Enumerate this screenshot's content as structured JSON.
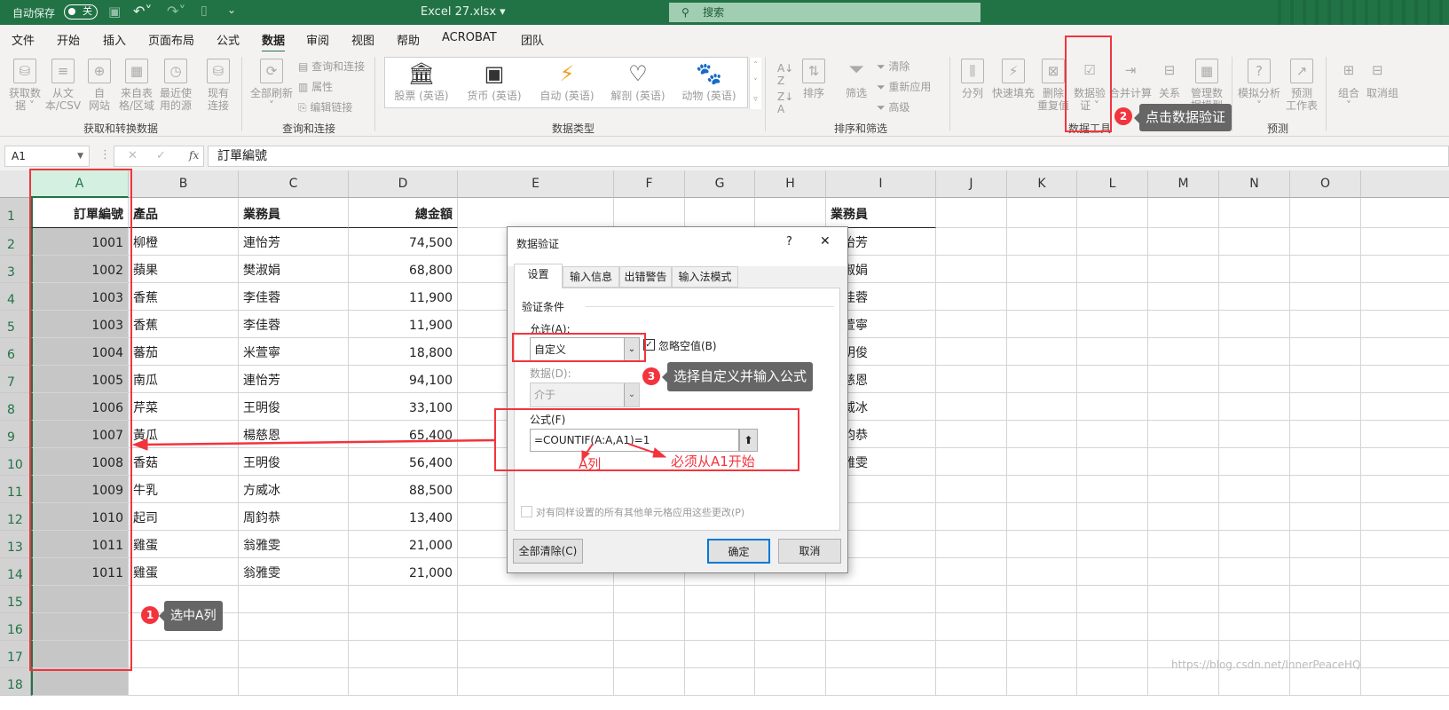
{
  "titlebar": {
    "autosave_label": "自动保存",
    "autosave_state": "关",
    "filename": "Excel 27.xlsx",
    "search_placeholder": "搜索"
  },
  "menu_tabs": [
    "文件",
    "开始",
    "插入",
    "页面布局",
    "公式",
    "数据",
    "审阅",
    "视图",
    "帮助",
    "ACROBAT",
    "团队"
  ],
  "active_tab": "数据",
  "ribbon": {
    "groups": [
      "获取和转换数据",
      "查询和连接",
      "数据类型",
      "排序和筛选",
      "数据工具",
      "预测"
    ],
    "get_data": [
      "获取数\n据 ˅",
      "从文\n本/CSV",
      "自\n网站",
      "来自表\n格/区域",
      "最近使\n用的源",
      "现有\n连接"
    ],
    "refresh_all": "全部刷新",
    "queries_connections": "查询和连接",
    "properties": "属性",
    "edit_links": "编辑链接",
    "data_types": [
      "股票 (英语)",
      "货币 (英语)",
      "自动 (英语)",
      "解剖 (英语)",
      "动物 (英语)"
    ],
    "sort": "排序",
    "filter": "筛选",
    "clear": "清除",
    "reapply": "重新应用",
    "advanced": "高级",
    "data_tools": [
      "分列",
      "快速填充",
      "删除\n重复值",
      "数据验\n证 ˅",
      "合并计算",
      "关系",
      "管理数\n据模型"
    ],
    "forecast": [
      "模拟分析\n˅",
      "预测\n工作表"
    ],
    "outline": [
      "组合\n˅",
      "取消组"
    ]
  },
  "formula_bar": {
    "name_box": "A1",
    "cancel": "✕",
    "enter": "✓",
    "fx": "fx",
    "content": "訂單編號"
  },
  "sheet": {
    "columns": [
      "A",
      "B",
      "C",
      "D",
      "E",
      "F",
      "G",
      "H",
      "I",
      "J",
      "K",
      "L",
      "M",
      "N",
      "O"
    ],
    "rows": [
      [
        "訂單編號",
        "產品",
        "業務員",
        "總金額",
        "",
        "",
        "",
        "",
        "業務員"
      ],
      [
        "1001",
        "柳橙",
        "連怡芳",
        "74,500",
        "",
        "",
        "",
        "",
        "連怡芳"
      ],
      [
        "1002",
        "蘋果",
        "樊淑娟",
        "68,800",
        "",
        "",
        "",
        "",
        "樊淑娟"
      ],
      [
        "1003",
        "香蕉",
        "李佳蓉",
        "11,900",
        "",
        "",
        "",
        "",
        "李佳蓉"
      ],
      [
        "1003",
        "香蕉",
        "李佳蓉",
        "11,900",
        "",
        "",
        "",
        "",
        "米萱寧"
      ],
      [
        "1004",
        "蕃茄",
        "米萱寧",
        "18,800",
        "",
        "",
        "",
        "",
        "王明俊"
      ],
      [
        "1005",
        "南瓜",
        "連怡芳",
        "94,100",
        "",
        "",
        "",
        "",
        "楊慈恩"
      ],
      [
        "1006",
        "芹菜",
        "王明俊",
        "33,100",
        "",
        "",
        "",
        "",
        "方威冰"
      ],
      [
        "1007",
        "黃瓜",
        "楊慈恩",
        "65,400",
        "",
        "",
        "",
        "",
        "周鈞恭"
      ],
      [
        "1008",
        "香菇",
        "王明俊",
        "56,400",
        "",
        "",
        "",
        "",
        "翁雅雯"
      ],
      [
        "1009",
        "牛乳",
        "方威冰",
        "88,500"
      ],
      [
        "1010",
        "起司",
        "周鈞恭",
        "13,400"
      ],
      [
        "1011",
        "雞蛋",
        "翁雅雯",
        "21,000"
      ],
      [
        "1011",
        "雞蛋",
        "翁雅雯",
        "21,000"
      ],
      [],
      [],
      [],
      []
    ]
  },
  "dialog": {
    "title": "数据验证",
    "help": "?",
    "close": "✕",
    "tabs": [
      "设置",
      "输入信息",
      "出错警告",
      "输入法模式"
    ],
    "section": "验证条件",
    "allow_label": "允许(A):",
    "allow_value": "自定义",
    "ignore_blank": "忽略空值(B)",
    "ignore_blank_checked": true,
    "data_label": "数据(D):",
    "data_value": "介于",
    "formula_label": "公式(F)",
    "formula_value": "=COUNTIF(A:A,A1)=1",
    "apply_all": "对有同样设置的所有其他单元格应用这些更改(P)",
    "clear_all": "全部清除(C)",
    "ok": "确定",
    "cancel": "取消"
  },
  "annotations": {
    "step1": {
      "num": "1",
      "text": "选中A列"
    },
    "step2": {
      "num": "2",
      "text": "点击数据验证"
    },
    "step3": {
      "num": "3",
      "text": "选择自定义并输入公式"
    },
    "note_a": "A列",
    "note_a1": "必须从A1开始",
    "color": "#f2343d"
  },
  "watermark": "https://blog.csdn.net/InnerPeaceHQ",
  "colors": {
    "excel_green": "#217346",
    "selection_gray": "#c6c6c6",
    "annotation_red": "#f2343d"
  }
}
